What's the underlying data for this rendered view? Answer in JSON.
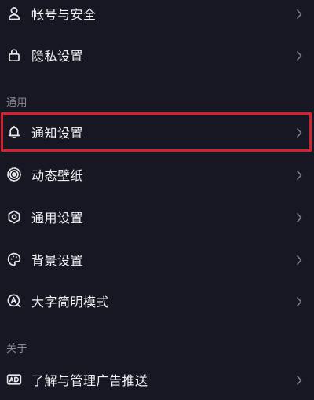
{
  "sections": {
    "general_title": "通用",
    "about_title": "关于"
  },
  "rows": {
    "account": {
      "label": "帐号与安全",
      "icon": "user-icon"
    },
    "privacy": {
      "label": "隐私设置",
      "icon": "lock-icon"
    },
    "notification": {
      "label": "通知设置",
      "icon": "bell-icon"
    },
    "wallpaper": {
      "label": "动态壁纸",
      "icon": "wallpaper-icon"
    },
    "general": {
      "label": "通用设置",
      "icon": "gear-icon"
    },
    "background": {
      "label": "背景设置",
      "icon": "palette-icon"
    },
    "largefont": {
      "label": "大字简明模式",
      "icon": "large-font-icon"
    },
    "ads": {
      "label": "了解与管理广告推送",
      "icon": "ad-icon"
    }
  },
  "colors": {
    "background": "#161722",
    "text": "#f2f2f4",
    "section_text": "#8a8b93",
    "chevron": "#7d7e86",
    "highlight": "#d8202c"
  }
}
